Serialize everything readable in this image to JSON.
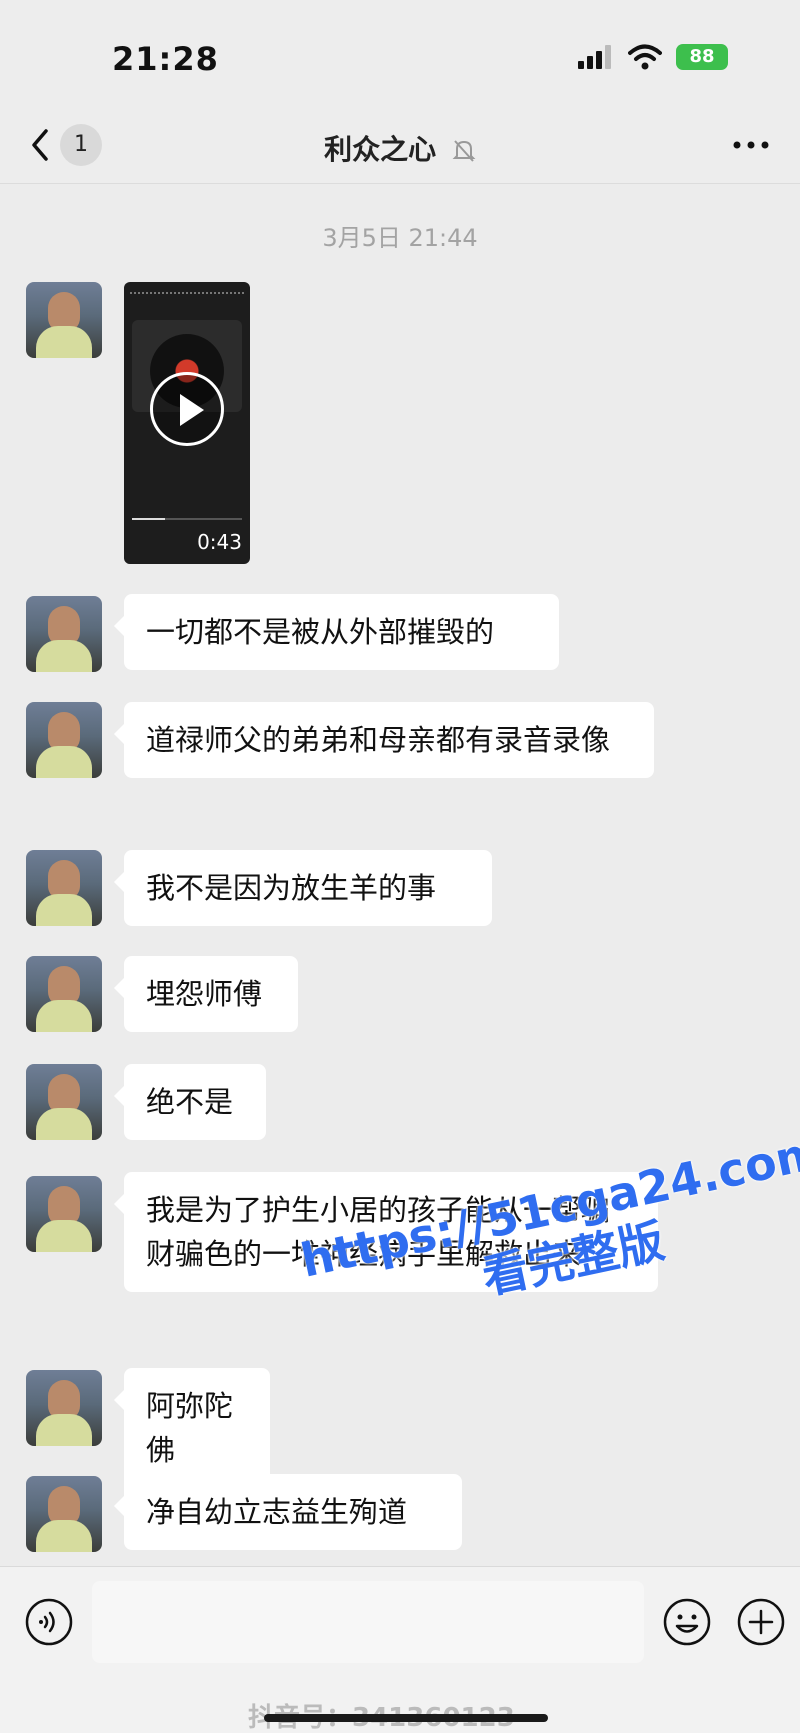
{
  "status": {
    "time": "21:28",
    "battery": "88"
  },
  "nav": {
    "back_count": "1",
    "title": "利众之心"
  },
  "chat": {
    "timestamp": "3月5日 21:44",
    "video": {
      "duration": "0:43"
    },
    "messages": [
      {
        "text": "一切都不是被从外部摧毁的"
      },
      {
        "text": "道禄师父的弟弟和母亲都有录音录像"
      },
      {
        "text": "我不是因为放生羊的事"
      },
      {
        "text": "埋怨师傅"
      },
      {
        "text": "绝不是"
      },
      {
        "text": "我是为了护生小居的孩子能从一帮骗财骗色的一堆神经病手里解救出来"
      },
      {
        "text": "阿弥陀佛"
      },
      {
        "text": "净自幼立志益生殉道"
      }
    ]
  },
  "footer": {
    "source": "抖音号：341360123"
  },
  "watermark": {
    "line1": "https://51cga24.com",
    "line2": "看完整版"
  },
  "colors": {
    "background": "#ececec",
    "bubble": "#ffffff",
    "battery": "#3dbf4d",
    "watermark": "#2f6df0"
  },
  "icons": [
    "signal-icon",
    "wifi-icon",
    "battery-icon",
    "back-chevron-icon",
    "mute-bell-icon",
    "more-icon",
    "play-icon",
    "voice-icon",
    "emoji-icon",
    "plus-icon"
  ]
}
